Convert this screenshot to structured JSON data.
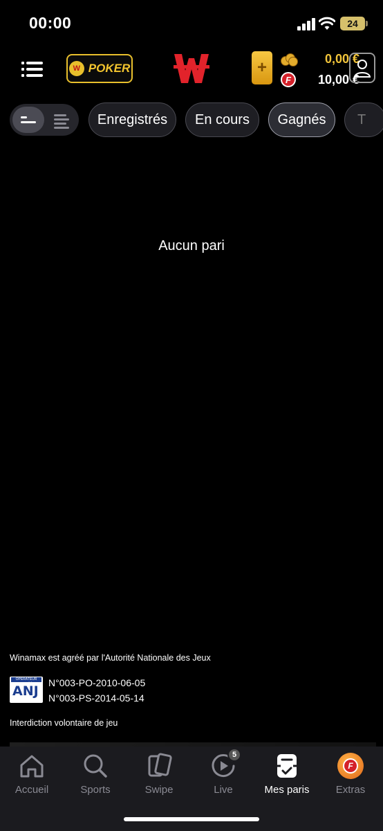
{
  "status_bar": {
    "time": "00:00",
    "battery": "24"
  },
  "header": {
    "poker_label": "POKER",
    "balance_real": "0,00 €",
    "balance_freebet": "10,00 €",
    "freebet_letter": "F",
    "deposit_symbol": "+"
  },
  "filters": {
    "tabs": [
      {
        "label": "Enregistrés"
      },
      {
        "label": "En cours"
      },
      {
        "label": "Gagnés"
      },
      {
        "label": "T"
      }
    ]
  },
  "main": {
    "empty_message": "Aucun pari"
  },
  "legal": {
    "approval_text": "Winamax est agréé par l'Autorité Nationale des Jeux",
    "anj_caption": "OPÉRATEUR AGRÉÉ",
    "anj_logo_text": "ANJ",
    "license_poker": "N°003-PO-2010-06-05",
    "license_sports": "N°003-PS-2014-05-14",
    "self_exclusion": "Interdiction volontaire de jeu"
  },
  "bottom_nav": {
    "items": [
      {
        "label": "Accueil"
      },
      {
        "label": "Sports"
      },
      {
        "label": "Swipe"
      },
      {
        "label": "Live",
        "badge": "5"
      },
      {
        "label": "Mes paris"
      },
      {
        "label": "Extras",
        "icon_letter": "F"
      }
    ]
  },
  "colors": {
    "background": "#000000",
    "accent_gold": "#f1c43a",
    "brand_red": "#e2232b",
    "nav_inactive": "#8a8a93"
  }
}
